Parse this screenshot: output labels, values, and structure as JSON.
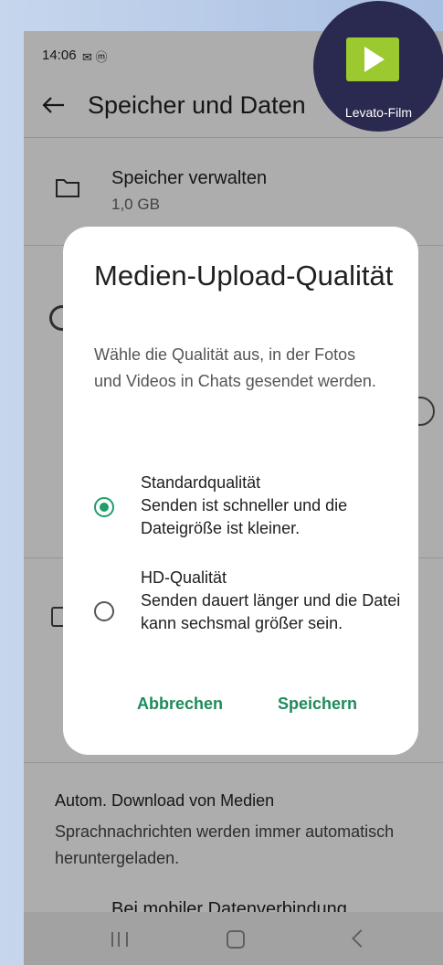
{
  "status_bar": {
    "time": "14:06",
    "icons": "✉ ⓜ"
  },
  "appbar": {
    "title": "Speicher und Daten"
  },
  "storage_row": {
    "title": "Speicher verwalten",
    "subtitle": "1,0 GB"
  },
  "auto_download": {
    "title": "Autom. Download von Medien",
    "description": "Sprachnachrichten werden immer automatisch heruntergeladen.",
    "mobile_label": "Bei mobiler Datenverbindung"
  },
  "dialog": {
    "title": "Medien-Upload-Qualität",
    "description": "Wähle die Qualität aus, in der Fotos und Videos in Chats gesendet werden.",
    "options": [
      {
        "title": "Standardqualität",
        "description": "Senden ist schneller und die Dateigröße ist kleiner.",
        "selected": true
      },
      {
        "title": "HD-Qualität",
        "description": "Senden dauert länger und die Datei kann sechsmal größer sein.",
        "selected": false
      }
    ],
    "cancel_label": "Abbrechen",
    "save_label": "Speichern"
  },
  "overlay": {
    "brand": "Levato-Film"
  },
  "colors": {
    "accent": "#1e8a5c",
    "radio_on": "#1e9e6a",
    "brand_bg": "#2a2950",
    "brand_logo": "#9bc92f"
  }
}
